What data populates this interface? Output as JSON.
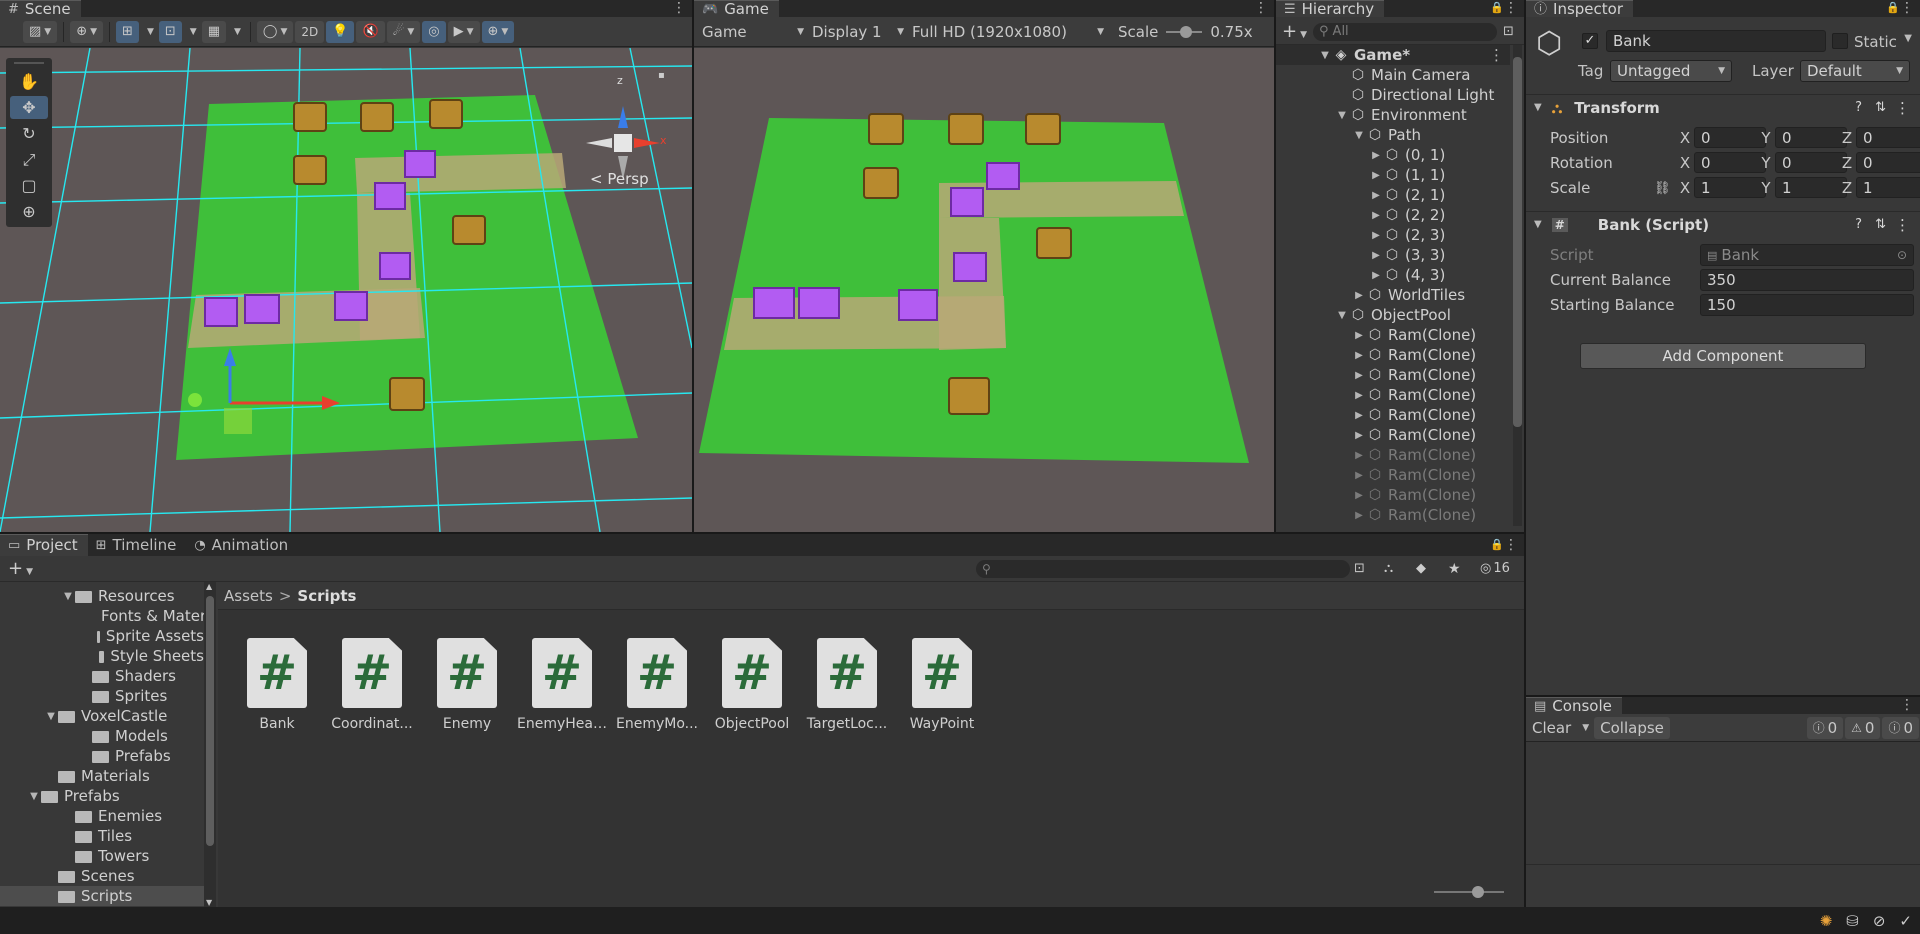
{
  "scene": {
    "tab_label": "Scene",
    "btn_2d": "2D",
    "persp_label": "Persp",
    "gizmo_z": "z",
    "gizmo_x": "x",
    "tools": [
      "hand-tool",
      "move-tool",
      "rotate-tool",
      "scale-tool",
      "rect-tool",
      "transform-tool"
    ]
  },
  "game": {
    "tab_label": "Game",
    "mode_dropdown": "Game",
    "display_dropdown": "Display 1",
    "resolution_dropdown": "Full HD (1920x1080)",
    "scale_label": "Scale",
    "scale_value": "0.75x"
  },
  "hierarchy": {
    "tab_label": "Hierarchy",
    "search_placeholder": "All",
    "scene_name": "Game*",
    "items": [
      {
        "label": "Main Camera",
        "indent": 1,
        "arrow": "",
        "dim": false
      },
      {
        "label": "Directional Light",
        "indent": 1,
        "arrow": "",
        "dim": false
      },
      {
        "label": "Environment",
        "indent": 1,
        "arrow": "open",
        "dim": false
      },
      {
        "label": "Path",
        "indent": 2,
        "arrow": "open",
        "dim": false
      },
      {
        "label": "(0, 1)",
        "indent": 3,
        "arrow": "closed",
        "dim": false
      },
      {
        "label": "(1, 1)",
        "indent": 3,
        "arrow": "closed",
        "dim": false
      },
      {
        "label": "(2, 1)",
        "indent": 3,
        "arrow": "closed",
        "dim": false
      },
      {
        "label": "(2, 2)",
        "indent": 3,
        "arrow": "closed",
        "dim": false
      },
      {
        "label": "(2, 3)",
        "indent": 3,
        "arrow": "closed",
        "dim": false
      },
      {
        "label": "(3, 3)",
        "indent": 3,
        "arrow": "closed",
        "dim": false
      },
      {
        "label": "(4, 3)",
        "indent": 3,
        "arrow": "closed",
        "dim": false
      },
      {
        "label": "WorldTiles",
        "indent": 2,
        "arrow": "closed",
        "dim": false
      },
      {
        "label": "ObjectPool",
        "indent": 1,
        "arrow": "open",
        "dim": false
      },
      {
        "label": "Ram(Clone)",
        "indent": 2,
        "arrow": "closed",
        "dim": false
      },
      {
        "label": "Ram(Clone)",
        "indent": 2,
        "arrow": "closed",
        "dim": false
      },
      {
        "label": "Ram(Clone)",
        "indent": 2,
        "arrow": "closed",
        "dim": false
      },
      {
        "label": "Ram(Clone)",
        "indent": 2,
        "arrow": "closed",
        "dim": false
      },
      {
        "label": "Ram(Clone)",
        "indent": 2,
        "arrow": "closed",
        "dim": false
      },
      {
        "label": "Ram(Clone)",
        "indent": 2,
        "arrow": "closed",
        "dim": false
      },
      {
        "label": "Ram(Clone)",
        "indent": 2,
        "arrow": "closed",
        "dim": true
      },
      {
        "label": "Ram(Clone)",
        "indent": 2,
        "arrow": "closed",
        "dim": true
      },
      {
        "label": "Ram(Clone)",
        "indent": 2,
        "arrow": "closed",
        "dim": true
      },
      {
        "label": "Ram(Clone)",
        "indent": 2,
        "arrow": "closed",
        "dim": true
      }
    ]
  },
  "inspector": {
    "tab_label": "Inspector",
    "object_name": "Bank",
    "static_label": "Static",
    "tag_label": "Tag",
    "tag_value": "Untagged",
    "layer_label": "Layer",
    "layer_value": "Default",
    "transform": {
      "title": "Transform",
      "position_label": "Position",
      "rotation_label": "Rotation",
      "scale_label": "Scale",
      "axis_x": "X",
      "axis_y": "Y",
      "axis_z": "Z",
      "position": [
        "0",
        "0",
        "0"
      ],
      "rotation": [
        "0",
        "0",
        "0"
      ],
      "scale": [
        "1",
        "1",
        "1"
      ]
    },
    "bank_script": {
      "title": "Bank (Script)",
      "script_label": "Script",
      "script_value": "Bank",
      "current_balance_label": "Current Balance",
      "current_balance": "350",
      "starting_balance_label": "Starting Balance",
      "starting_balance": "150"
    },
    "add_component": "Add Component"
  },
  "console": {
    "tab_label": "Console",
    "clear": "Clear",
    "collapse": "Collapse",
    "log_count": "0",
    "warn_count": "0",
    "error_count": "0"
  },
  "project": {
    "tabs": [
      "Project",
      "Timeline",
      "Animation"
    ],
    "hidden_count": "16",
    "breadcrumb_root": "Assets",
    "breadcrumb_current": "Scripts",
    "tree": [
      {
        "label": "Resources",
        "indent": 3,
        "arrow": "open",
        "selected": false
      },
      {
        "label": "Fonts & Materials",
        "indent": 5,
        "arrow": "",
        "selected": false
      },
      {
        "label": "Sprite Assets",
        "indent": 5,
        "arrow": "",
        "selected": false
      },
      {
        "label": "Style Sheets",
        "indent": 5,
        "arrow": "",
        "selected": false
      },
      {
        "label": "Shaders",
        "indent": 4,
        "arrow": "",
        "selected": false
      },
      {
        "label": "Sprites",
        "indent": 4,
        "arrow": "",
        "selected": false
      },
      {
        "label": "VoxelCastle",
        "indent": 2,
        "arrow": "open",
        "selected": false
      },
      {
        "label": "Models",
        "indent": 4,
        "arrow": "",
        "selected": false
      },
      {
        "label": "Prefabs",
        "indent": 4,
        "arrow": "",
        "selected": false
      },
      {
        "label": "Materials",
        "indent": 2,
        "arrow": "",
        "selected": false
      },
      {
        "label": "Prefabs",
        "indent": 1,
        "arrow": "open",
        "selected": false
      },
      {
        "label": "Enemies",
        "indent": 3,
        "arrow": "",
        "selected": false
      },
      {
        "label": "Tiles",
        "indent": 3,
        "arrow": "",
        "selected": false
      },
      {
        "label": "Towers",
        "indent": 3,
        "arrow": "",
        "selected": false
      },
      {
        "label": "Scenes",
        "indent": 2,
        "arrow": "",
        "selected": false
      },
      {
        "label": "Scripts",
        "indent": 2,
        "arrow": "",
        "selected": true
      }
    ],
    "assets": [
      "Bank",
      "Coordinat...",
      "Enemy",
      "EnemyHeal...",
      "EnemyMo...",
      "ObjectPool",
      "TargetLoc...",
      "WayPoint"
    ]
  },
  "colors": {
    "accent": "#46607c",
    "grass": "#3fbf3a",
    "path": "#b9a877",
    "purple": "#b25cf2",
    "grid": "#26e8f0"
  }
}
